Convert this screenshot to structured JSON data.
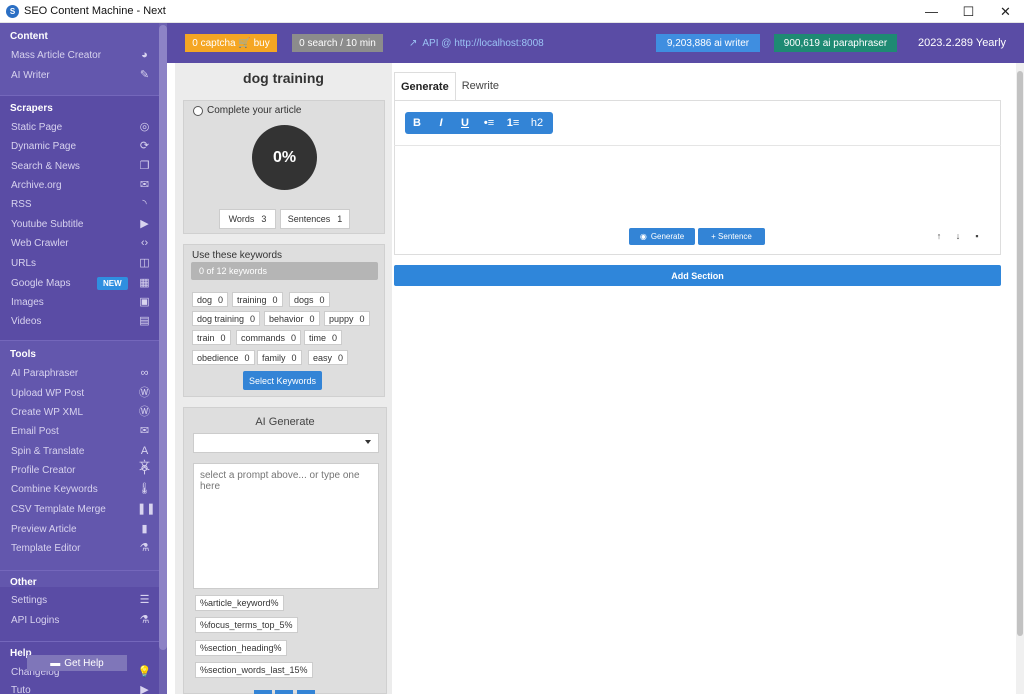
{
  "window": {
    "title": "SEO Content Machine - Next",
    "controls": {
      "minimize": "—",
      "maximize": "☐",
      "close": "✕"
    }
  },
  "sidebar": {
    "sections": [
      {
        "heading": "Content",
        "items": [
          {
            "label": "Mass Article Creator",
            "icon": "palette-icon"
          },
          {
            "label": "AI Writer",
            "icon": "edit-icon"
          }
        ]
      },
      {
        "heading": "Scrapers",
        "items": [
          {
            "label": "Static Page",
            "icon": "compass-icon"
          },
          {
            "label": "Dynamic Page",
            "icon": "sync-icon"
          },
          {
            "label": "Search & News",
            "icon": "copy-icon"
          },
          {
            "label": "Archive.org",
            "icon": "archive-icon"
          },
          {
            "label": "RSS",
            "icon": "rss-icon"
          },
          {
            "label": "Youtube Subtitle",
            "icon": "play-icon"
          },
          {
            "label": "Web Crawler",
            "icon": "code-icon"
          },
          {
            "label": "URLs",
            "icon": "window-icon"
          },
          {
            "label": "Google Maps",
            "icon": "map-icon",
            "badge": "NEW"
          },
          {
            "label": "Images",
            "icon": "image-icon"
          },
          {
            "label": "Videos",
            "icon": "film-icon"
          }
        ]
      },
      {
        "heading": "Tools",
        "items": [
          {
            "label": "AI Paraphraser",
            "icon": "infinity-icon"
          },
          {
            "label": "Upload WP Post",
            "icon": "wordpress-icon"
          },
          {
            "label": "Create WP XML",
            "icon": "wordpress-icon"
          },
          {
            "label": "Email Post",
            "icon": "envelope-icon"
          },
          {
            "label": "Spin & Translate",
            "icon": "translate-icon"
          },
          {
            "label": "Profile Creator",
            "icon": "user-icon"
          },
          {
            "label": "Combine Keywords",
            "icon": "thermometer-icon"
          },
          {
            "label": "CSV Template Merge",
            "icon": "columns-icon"
          },
          {
            "label": "Preview Article",
            "icon": "file-icon"
          },
          {
            "label": "Template Editor",
            "icon": "flask-icon"
          }
        ]
      },
      {
        "heading": "Other",
        "items": [
          {
            "label": "Settings",
            "icon": "sliders-icon"
          },
          {
            "label": "API Logins",
            "icon": "flask-icon"
          }
        ]
      },
      {
        "heading": "Help",
        "items": [
          {
            "label": "Changelog",
            "icon": "lightbulb-icon"
          },
          {
            "label": "Tuto",
            "icon": "play-icon"
          }
        ]
      }
    ],
    "get_help": "Get Help"
  },
  "topbar": {
    "captcha": "0 captcha 🛒 buy",
    "search": "0 search / 10 min",
    "api": "API @ http://localhost:8008",
    "ai_writer": "9,203,886 ai writer",
    "ai_paraphraser": "900,619 ai paraphraser",
    "version": "2023.2.289 Yearly"
  },
  "article": {
    "keyword": "dog training",
    "complete_label": "Complete your article",
    "progress": "0%",
    "words_label": "Words",
    "words_value": "3",
    "sentences_label": "Sentences",
    "sentences_value": "1"
  },
  "keywords": {
    "heading": "Use these keywords",
    "progress_text": "0 of 12 keywords",
    "items": [
      {
        "term": "dog",
        "count": "0"
      },
      {
        "term": "training",
        "count": "0"
      },
      {
        "term": "dogs",
        "count": "0"
      },
      {
        "term": "dog training",
        "count": "0"
      },
      {
        "term": "behavior",
        "count": "0"
      },
      {
        "term": "puppy",
        "count": "0"
      },
      {
        "term": "train",
        "count": "0"
      },
      {
        "term": "commands",
        "count": "0"
      },
      {
        "term": "time",
        "count": "0"
      },
      {
        "term": "obedience",
        "count": "0"
      },
      {
        "term": "family",
        "count": "0"
      },
      {
        "term": "easy",
        "count": "0"
      }
    ],
    "select_button": "Select Keywords"
  },
  "ai_generate": {
    "title": "AI Generate",
    "select_value": "",
    "placeholder": "select a prompt above... or type one here",
    "variables": [
      "%article_keyword%",
      "%focus_terms_top_5%",
      "%section_heading%",
      "%section_words_last_15%"
    ]
  },
  "editor": {
    "tabs": [
      "Generate",
      "Rewrite"
    ],
    "format_buttons": [
      "B",
      "I",
      "U",
      "•≡",
      "1≡",
      "h2"
    ],
    "generate_button": "Generate",
    "sentence_button": "+ Sentence",
    "add_section": "Add Section"
  }
}
